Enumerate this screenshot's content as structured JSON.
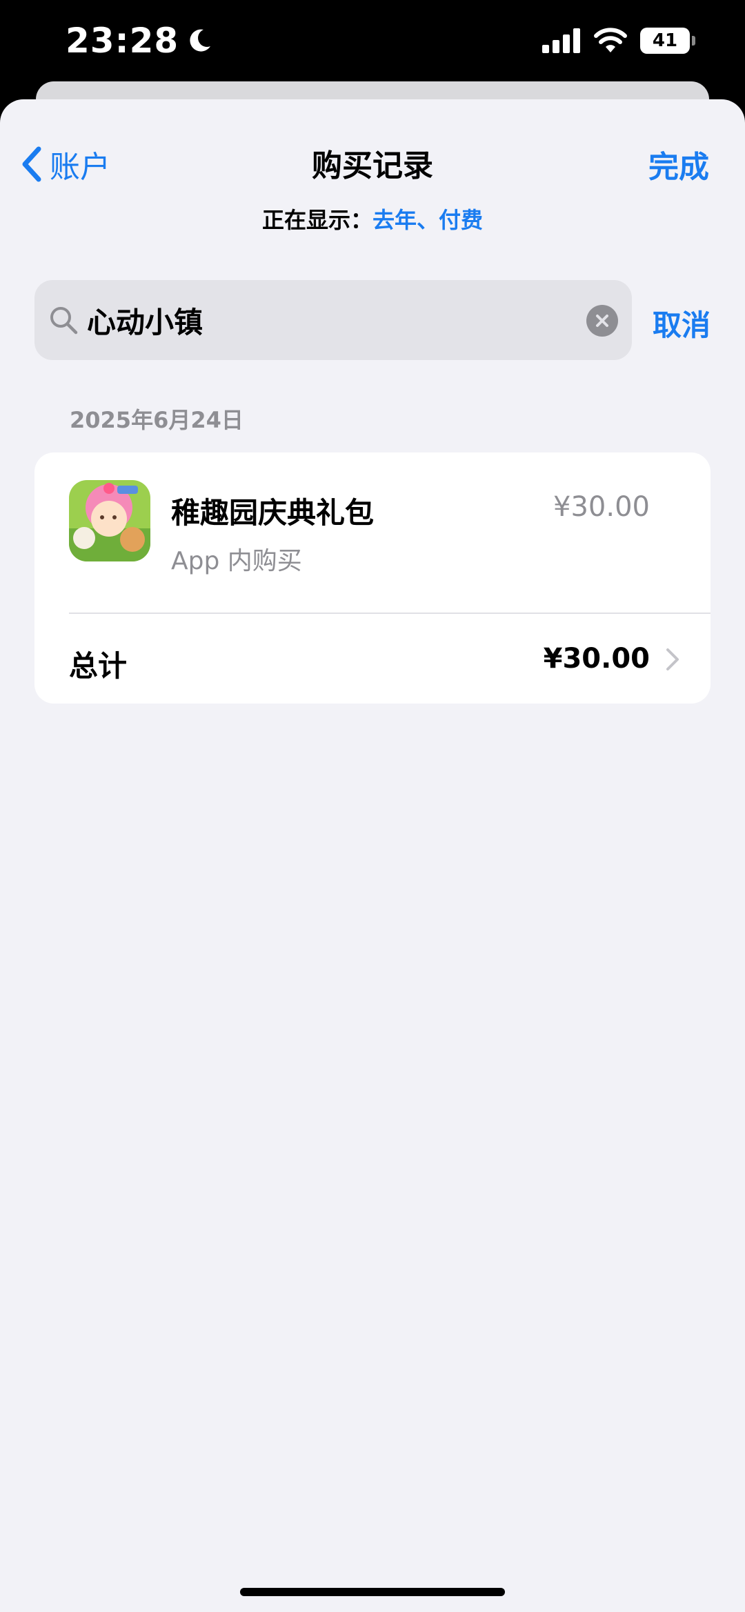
{
  "status_bar": {
    "time": "23:28",
    "battery": "41",
    "icons": [
      "moon-icon",
      "cellular-signal-icon",
      "wifi-icon",
      "battery-icon"
    ]
  },
  "nav": {
    "back_label": "账户",
    "title": "购买记录",
    "done_label": "完成"
  },
  "filter": {
    "label": "正在显示：",
    "value": "去年、付费"
  },
  "search": {
    "value": "心动小镇",
    "cancel_label": "取消"
  },
  "purchases": {
    "date": "2025年6月24日",
    "item": {
      "title": "稚趣园庆典礼包",
      "subtitle": "App 内购买",
      "price": "¥30.00"
    },
    "total_label": "总计",
    "total_price": "¥30.00"
  },
  "colors": {
    "accent": "#1a7cf0",
    "background": "#f2f2f7",
    "secondary_text": "#8e8e93"
  }
}
